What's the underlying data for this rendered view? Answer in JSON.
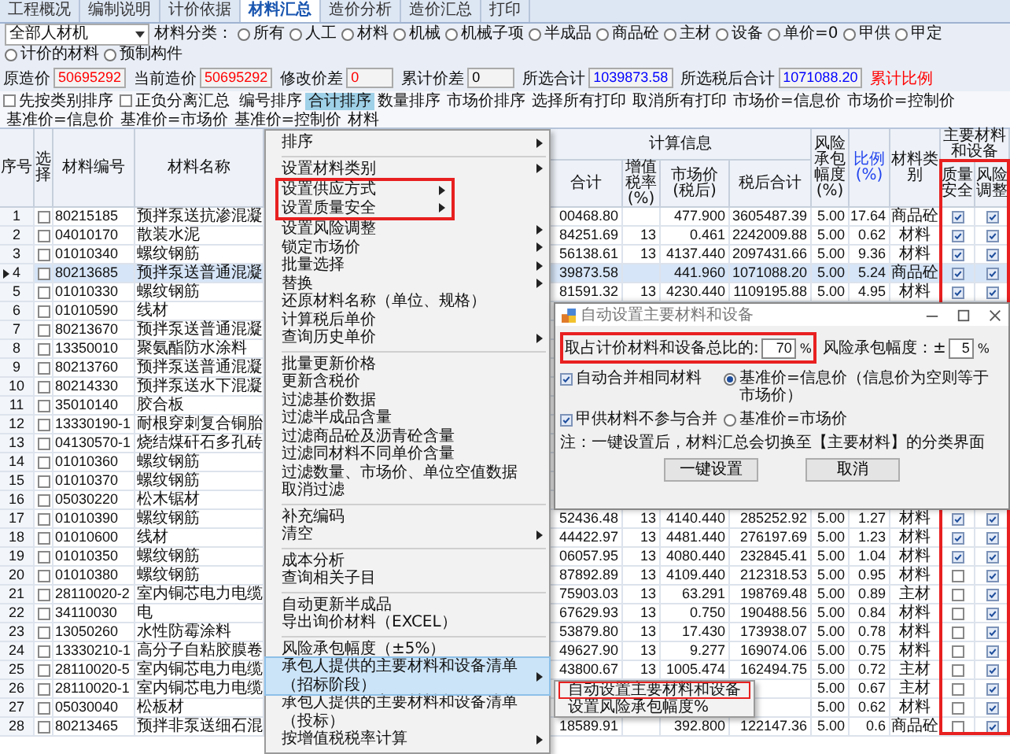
{
  "tabs": [
    {
      "label": "工程概况",
      "selected": false
    },
    {
      "label": "编制说明",
      "selected": false
    },
    {
      "label": "计价依据",
      "selected": false
    },
    {
      "label": "材料汇总",
      "selected": true
    },
    {
      "label": "造价分析",
      "selected": false
    },
    {
      "label": "造价汇总",
      "selected": false
    },
    {
      "label": "打印",
      "selected": false
    }
  ],
  "filter": {
    "dropdown": "全部人材机",
    "category_label": "材料分类：",
    "options": [
      {
        "label": "所有",
        "selected": false
      },
      {
        "label": "人工",
        "selected": false
      },
      {
        "label": "材料",
        "selected": false
      },
      {
        "label": "机械",
        "selected": false
      },
      {
        "label": "机械子项",
        "selected": false
      },
      {
        "label": "半成品",
        "selected": false
      },
      {
        "label": "商品砼",
        "selected": false
      },
      {
        "label": "主材",
        "selected": false
      },
      {
        "label": "设备",
        "selected": false
      },
      {
        "label": "单价=0",
        "selected": false
      },
      {
        "label": "甲供",
        "selected": false
      },
      {
        "label": "甲定",
        "selected": false
      },
      {
        "label": "计价的材料",
        "selected": false
      },
      {
        "label": "预制构件",
        "selected": false
      }
    ]
  },
  "prices": [
    {
      "label": "原造价",
      "value": "50695292",
      "color": "#ff0000"
    },
    {
      "label": "当前造价",
      "value": "50695292",
      "color": "#ff0000"
    },
    {
      "label": "修改价差",
      "value": "0",
      "color": "#ff0000"
    },
    {
      "label": "累计价差",
      "value": "0",
      "color": "#000000"
    },
    {
      "label": "所选合计",
      "value": "1039873.58",
      "color": "#0000ff"
    },
    {
      "label": "所选税后合计",
      "value": "1071088.20",
      "color": "#0000ff"
    }
  ],
  "ratio_label": "累计比例",
  "toolbar": {
    "checkboxes": [
      {
        "label": "先按类别排序",
        "checked": false
      },
      {
        "label": "正负分离汇总",
        "checked": false
      }
    ],
    "buttons": [
      {
        "label": "编号排序",
        "selected": false
      },
      {
        "label": "合计排序",
        "selected": true
      },
      {
        "label": "数量排序",
        "selected": false
      },
      {
        "label": "市场价排序",
        "selected": false
      },
      {
        "label": "选择所有打印",
        "selected": false
      },
      {
        "label": "取消所有打印",
        "selected": false
      },
      {
        "label": "市场价=信息价",
        "selected": false
      },
      {
        "label": "市场价=控制价",
        "selected": false
      },
      {
        "label": "基准价=信息价",
        "selected": false
      },
      {
        "label": "基准价=市场价",
        "selected": false
      },
      {
        "label": "基准价=控制价",
        "selected": false
      },
      {
        "label": "材料",
        "selected": false
      }
    ]
  },
  "table": {
    "main_columns_marked": true,
    "columns": {
      "seq": "序号",
      "select": "选择",
      "code": "材料编号",
      "name": "材料名称",
      "group_calc": "计算信息",
      "total": "合计",
      "vat": "增值税率(%)",
      "market": "市场价(税后)",
      "after_tax": "税后合计",
      "risk": "风险承包幅度(%)",
      "ratio": "比例(%)",
      "category": "材料类别",
      "group_main": "主要材料和设备",
      "quality": "质量安全",
      "risk_adjust": "风险调整"
    },
    "rows": [
      {
        "seq": "1",
        "checked": false,
        "selected": false,
        "code": "80215185",
        "name": "预拌泵送抗渗混凝",
        "total": "00468.80",
        "market": "477.900",
        "after_tax": "3605487.39",
        "risk": "5.00",
        "ratio": "17.64",
        "category": "商品砼",
        "quality": true,
        "risk_adjust": true
      },
      {
        "seq": "2",
        "checked": false,
        "selected": false,
        "code": "04010170",
        "name": "散装水泥",
        "total": "84251.69",
        "vat": "13",
        "market": "0.461",
        "after_tax": "2242009.88",
        "risk": "5.00",
        "ratio": "0.62",
        "category": "材料",
        "quality": true,
        "risk_adjust": true
      },
      {
        "seq": "3",
        "checked": false,
        "selected": false,
        "code": "01010340",
        "name": "螺纹钢筋",
        "total": "56138.61",
        "vat": "13",
        "market": "4137.440",
        "after_tax": "2097431.66",
        "risk": "5.00",
        "ratio": "9.36",
        "category": "材料",
        "quality": true,
        "risk_adjust": true
      },
      {
        "seq": "4",
        "checked": false,
        "selected": true,
        "code": "80213685",
        "name": "预拌泵送普通混凝",
        "total": "39873.58",
        "market": "441.960",
        "after_tax": "1071088.20",
        "risk": "5.00",
        "ratio": "5.24",
        "category": "商品砼",
        "quality": true,
        "risk_adjust": true
      },
      {
        "seq": "5",
        "checked": false,
        "selected": false,
        "code": "01010330",
        "name": "螺纹钢筋",
        "total": "81591.32",
        "vat": "13",
        "market": "4230.440",
        "after_tax": "1109195.88",
        "risk": "5.00",
        "ratio": "4.95",
        "category": "材料",
        "quality": true,
        "risk_adjust": true
      },
      {
        "seq": "6",
        "checked": false,
        "selected": false,
        "code": "01010590",
        "name": "线材"
      },
      {
        "seq": "7",
        "checked": false,
        "selected": false,
        "code": "80213670",
        "name": "预拌泵送普通混凝"
      },
      {
        "seq": "8",
        "checked": false,
        "selected": false,
        "code": "13350010",
        "name": "聚氨酯防水涂料"
      },
      {
        "seq": "9",
        "checked": false,
        "selected": false,
        "code": "80213760",
        "name": "预拌泵送普通混凝"
      },
      {
        "seq": "10",
        "checked": false,
        "selected": false,
        "code": "80214330",
        "name": "预拌泵送水下混凝"
      },
      {
        "seq": "11",
        "checked": false,
        "selected": false,
        "code": "35010140",
        "name": "胶合板"
      },
      {
        "seq": "12",
        "checked": false,
        "selected": false,
        "code": "13330190-1",
        "name": "耐根穿刺复合铜胎"
      },
      {
        "seq": "13",
        "checked": false,
        "selected": false,
        "code": "04130570-1",
        "name": "烧结煤矸石多孔砖"
      },
      {
        "seq": "14",
        "checked": false,
        "selected": false,
        "code": "01010360",
        "name": "螺纹钢筋"
      },
      {
        "seq": "15",
        "checked": false,
        "selected": false,
        "code": "01010370",
        "name": "螺纹钢筋"
      },
      {
        "seq": "16",
        "checked": false,
        "selected": false,
        "code": "05030220",
        "name": "松木锯材"
      },
      {
        "seq": "17",
        "checked": false,
        "selected": false,
        "code": "01010390",
        "name": "螺纹钢筋",
        "total": "52436.48",
        "vat": "13",
        "market": "4140.440",
        "after_tax": "285252.92",
        "risk": "5.00",
        "ratio": "1.27",
        "category": "材料",
        "quality": true,
        "risk_adjust": true
      },
      {
        "seq": "18",
        "checked": false,
        "selected": false,
        "code": "01010600",
        "name": "线材",
        "total": "44422.97",
        "vat": "13",
        "market": "4481.440",
        "after_tax": "276197.69",
        "risk": "5.00",
        "ratio": "1.23",
        "category": "材料",
        "quality": true,
        "risk_adjust": true
      },
      {
        "seq": "19",
        "checked": false,
        "selected": false,
        "code": "01010350",
        "name": "螺纹钢筋",
        "total": "06057.95",
        "vat": "13",
        "market": "4080.440",
        "after_tax": "232845.41",
        "risk": "5.00",
        "ratio": "1.04",
        "category": "材料",
        "quality": true,
        "risk_adjust": true
      },
      {
        "seq": "20",
        "checked": false,
        "selected": false,
        "code": "01010380",
        "name": "螺纹钢筋",
        "total": "87892.89",
        "vat": "13",
        "market": "4109.440",
        "after_tax": "212318.53",
        "risk": "5.00",
        "ratio": "0.95",
        "category": "材料",
        "quality": false,
        "risk_adjust": true
      },
      {
        "seq": "21",
        "checked": false,
        "selected": false,
        "code": "28110020-2",
        "name": "室内铜芯电力电缆",
        "total": "75903.03",
        "vat": "13",
        "market": "63.291",
        "after_tax": "198769.48",
        "risk": "5.00",
        "ratio": "0.89",
        "category": "主材",
        "quality": false,
        "risk_adjust": true
      },
      {
        "seq": "22",
        "checked": false,
        "selected": false,
        "code": "34110030",
        "name": "电",
        "total": "67629.93",
        "vat": "13",
        "market": "0.750",
        "after_tax": "190488.56",
        "risk": "5.00",
        "ratio": "0.84",
        "category": "材料",
        "quality": false,
        "risk_adjust": true
      },
      {
        "seq": "23",
        "checked": false,
        "selected": false,
        "code": "13050260",
        "name": "水性防霉涂料",
        "total": "53879.80",
        "vat": "13",
        "market": "17.430",
        "after_tax": "173938.07",
        "risk": "5.00",
        "ratio": "0.78",
        "category": "材料",
        "quality": false,
        "risk_adjust": true
      },
      {
        "seq": "24",
        "checked": false,
        "selected": false,
        "code": "13330210-1",
        "name": "高分子自粘胶膜卷",
        "total": "49627.90",
        "vat": "13",
        "market": "9.277",
        "after_tax": "169074.06",
        "risk": "5.00",
        "ratio": "0.75",
        "category": "材料",
        "quality": false,
        "risk_adjust": true
      },
      {
        "seq": "25",
        "checked": false,
        "selected": false,
        "code": "28110020-5",
        "name": "室内铜芯电力电缆",
        "total": "43800.67",
        "vat": "13",
        "market": "1005.474",
        "after_tax": "162494.75",
        "risk": "5.00",
        "ratio": "0.72",
        "category": "主材",
        "quality": false,
        "risk_adjust": true
      },
      {
        "seq": "26",
        "checked": false,
        "selected": false,
        "code": "28110020-1",
        "name": "室内铜芯电力电缆",
        "risk": "5.00",
        "ratio": "0.67",
        "category": "主材",
        "quality": false,
        "risk_adjust": true
      },
      {
        "seq": "27",
        "checked": false,
        "selected": false,
        "code": "05030040",
        "name": "松板材",
        "risk": "5.00",
        "ratio": "0.62",
        "category": "材料",
        "quality": false,
        "risk_adjust": true
      },
      {
        "seq": "28",
        "checked": false,
        "selected": false,
        "code": "80213465",
        "name": "预拌非泵送细石混",
        "total": "18589.91",
        "market": "392.800",
        "after_tax": "122147.36",
        "risk": "5.00",
        "ratio": "0.6",
        "category": "商品砼",
        "quality": false,
        "risk_adjust": true
      }
    ]
  },
  "menu": {
    "sections": [
      {
        "items": [
          {
            "label": "排序",
            "submenu": true,
            "selected": false,
            "marked": false
          }
        ]
      },
      {
        "items": [
          {
            "label": "设置材料类别",
            "submenu": true,
            "selected": false,
            "marked": false
          },
          {
            "label": "设置供应方式",
            "submenu": true,
            "selected": false,
            "marked": true
          },
          {
            "label": "设置质量安全",
            "submenu": true,
            "selected": false,
            "marked": true
          },
          {
            "label": "设置风险调整",
            "submenu": true,
            "selected": false,
            "marked": false
          },
          {
            "label": "锁定市场价",
            "submenu": true,
            "selected": false,
            "marked": false
          },
          {
            "label": "批量选择",
            "submenu": true,
            "selected": false,
            "marked": false
          },
          {
            "label": "替换",
            "submenu": true,
            "selected": false,
            "marked": false
          },
          {
            "label": "还原材料名称（单位、规格）",
            "submenu": false,
            "selected": false,
            "marked": false
          },
          {
            "label": "计算税后单价",
            "submenu": false,
            "selected": false,
            "marked": false
          },
          {
            "label": "查询历史单价",
            "submenu": true,
            "selected": false,
            "marked": false
          }
        ]
      },
      {
        "items": [
          {
            "label": "批量更新价格",
            "submenu": false,
            "selected": false,
            "marked": false
          },
          {
            "label": "更新含税价",
            "submenu": false,
            "selected": false,
            "marked": false
          },
          {
            "label": "过滤基价数据",
            "submenu": false,
            "selected": false,
            "marked": false
          },
          {
            "label": "过滤半成品含量",
            "submenu": false,
            "selected": false,
            "marked": false
          },
          {
            "label": "过滤商品砼及沥青砼含量",
            "submenu": false,
            "selected": false,
            "marked": false
          },
          {
            "label": "过滤同材料不同单价含量",
            "submenu": false,
            "selected": false,
            "marked": false
          },
          {
            "label": "过滤数量、市场价、单位空值数据",
            "submenu": false,
            "selected": false,
            "marked": false
          },
          {
            "label": "取消过滤",
            "submenu": false,
            "selected": false,
            "marked": false
          }
        ]
      },
      {
        "items": [
          {
            "label": "补充编码",
            "submenu": false,
            "selected": false,
            "marked": false
          },
          {
            "label": "清空",
            "submenu": true,
            "selected": false,
            "marked": false
          }
        ]
      },
      {
        "items": [
          {
            "label": "成本分析",
            "submenu": false,
            "selected": false,
            "marked": false
          },
          {
            "label": "查询相关子目",
            "submenu": false,
            "selected": false,
            "marked": false
          }
        ]
      },
      {
        "items": [
          {
            "label": "自动更新半成品",
            "submenu": false,
            "selected": false,
            "marked": false
          },
          {
            "label": "导出询价材料（EXCEL）",
            "submenu": false,
            "selected": false,
            "marked": false
          }
        ]
      },
      {
        "items": [
          {
            "label": "风险承包幅度（±5%）",
            "submenu": false,
            "selected": false,
            "marked": false
          },
          {
            "label": "承包人提供的主要材料和设备清单（招标阶段）",
            "submenu": true,
            "selected": true,
            "marked": false
          },
          {
            "label": "承包人提供的主要材料和设备清单（投标）",
            "submenu": false,
            "selected": false,
            "marked": false
          },
          {
            "label": "按增值税税率计算",
            "submenu": true,
            "selected": false,
            "marked": false
          }
        ]
      }
    ]
  },
  "submenu": {
    "items": [
      {
        "label": "自动设置主要材料和设备",
        "marked": true
      },
      {
        "label": "设置风险承包幅度%",
        "marked": false
      }
    ]
  },
  "dialog": {
    "title": "自动设置主要材料和设备",
    "ratio": {
      "label": "取占计价材料和设备总比的:",
      "value": "70",
      "unit": "%",
      "marked": true
    },
    "risk": {
      "label": "风险承包幅度：±",
      "value": "5",
      "unit": "%"
    },
    "options": [
      {
        "kind": "checkbox",
        "label": "自动合并相同材料",
        "checked": true
      },
      {
        "kind": "radio",
        "label": "基准价=信息价（信息价为空则等于市场价）",
        "selected": true
      },
      {
        "kind": "checkbox",
        "label": "甲供材料不参与合并",
        "checked": true
      },
      {
        "kind": "radio",
        "label": "基准价=市场价",
        "selected": false
      }
    ],
    "note": "注：一键设置后，材料汇总会切换至【主要材料】的分类界面",
    "buttons": [
      "一键设置",
      "取消"
    ]
  }
}
